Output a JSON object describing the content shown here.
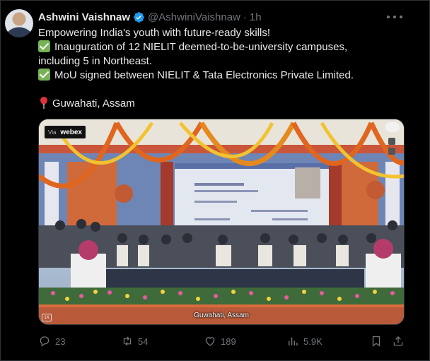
{
  "author": {
    "name": "Ashwini Vaishnaw",
    "handle": "@AshwiniVaishnaw",
    "separator": "·",
    "time": "1h"
  },
  "tweet": {
    "line1": "Empowering India's youth with future-ready skills!",
    "line2": "Inauguration of 12 NIELIT deemed-to-be-university campuses,",
    "line3": "including 5 in Northeast.",
    "line4": "MoU signed between NIELIT & Tata Electronics Private Limited.",
    "location": "Guwahati, Assam"
  },
  "media": {
    "watermark_via": "Via",
    "watermark_brand": "webex",
    "caption": "Guwahati, Assam",
    "badge": "1X"
  },
  "actions": {
    "replies": "23",
    "reposts": "54",
    "likes": "189",
    "views": "5.9K"
  },
  "icons": {
    "verified": "verified-badge-icon",
    "more": "more-options-icon",
    "reply": "reply-icon",
    "repost": "repost-icon",
    "like": "heart-icon",
    "views": "views-chart-icon",
    "bookmark": "bookmark-icon",
    "share": "share-icon"
  },
  "colors": {
    "background": "#000000",
    "text": "#e7e9ea",
    "muted": "#71767b",
    "verified": "#1d9bf0",
    "check": "#77b255"
  }
}
